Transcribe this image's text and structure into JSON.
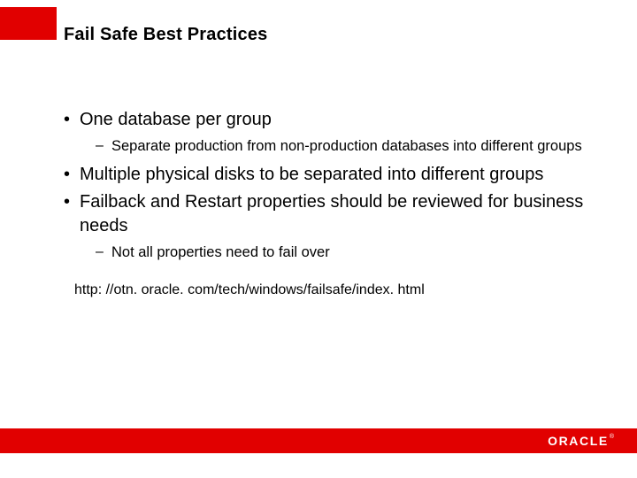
{
  "title": "Fail Safe Best Practices",
  "bullets": [
    {
      "text": "One database per group",
      "sub": [
        "Separate production from non-production databases into different groups"
      ]
    },
    {
      "text": "Multiple physical disks to be separated into different groups",
      "sub": []
    },
    {
      "text": "Failback and Restart properties should be reviewed for business needs",
      "sub": [
        "Not all properties need to fail over"
      ]
    }
  ],
  "url": "http: //otn. oracle. com/tech/windows/failsafe/index. html",
  "logo_text": "ORACLE",
  "logo_reg": "®"
}
